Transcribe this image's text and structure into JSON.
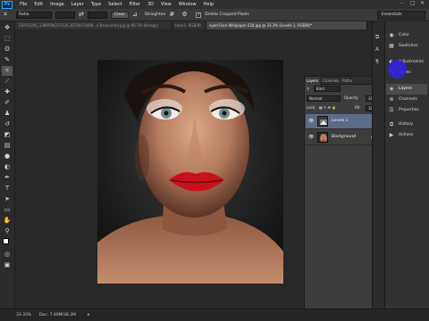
{
  "app": {
    "logo": "Ps"
  },
  "menu": [
    "File",
    "Edit",
    "Image",
    "Layer",
    "Type",
    "Select",
    "Filter",
    "3D",
    "View",
    "Window",
    "Help"
  ],
  "window_controls": {
    "minimize": "–",
    "maximize": "□",
    "close": "✕"
  },
  "options_bar": {
    "tool_icon": "crop-tool-icon",
    "ratio_select": "Ratio",
    "clear_button": "Clear",
    "straighten_label": "Straighten",
    "delete_cropped_label": "Delete Cropped Pixels",
    "delete_cropped_checked": "✓"
  },
  "workspace": {
    "label": "Essentials"
  },
  "tabs": [
    {
      "label": "1307f2345_1399594237126_6530073489...s-Recovered.jpg @ 66.7% (Hungry"
    },
    {
      "label": "Hear1, RGB/8)"
    },
    {
      "label": "eyed-Face-Wallpaper-224.jpg @ 33.3% (Levels 1, RGB/8)*"
    }
  ],
  "status": {
    "zoom": "33.33%",
    "doc": "Doc: 7.40M/38.2M"
  },
  "layers_panel": {
    "tabs": [
      "Layers",
      "Channels",
      "Paths"
    ],
    "menu_icon": "≡",
    "kind_label": "Kind",
    "blend_mode": "Normal",
    "opacity_label": "Opacity:",
    "opacity_value": "100%",
    "lock_label": "Lock:",
    "fill_label": "Fill:",
    "fill_value": "100%",
    "layers": [
      {
        "name": "Levels 1",
        "selected": true
      },
      {
        "name": "Background",
        "selected": false,
        "locked": true
      }
    ]
  },
  "dock": [
    {
      "label": "Color",
      "icon": "color-icon"
    },
    {
      "label": "Swatches",
      "icon": "swatches-icon"
    },
    {
      "label": "Adjustments",
      "icon": "adjustments-icon"
    },
    {
      "label": "Styles",
      "icon": "styles-icon"
    },
    {
      "label": "Layers",
      "icon": "layers-icon",
      "active": true
    },
    {
      "label": "Channels",
      "icon": "channels-icon"
    },
    {
      "label": "Properties",
      "icon": "properties-icon"
    },
    {
      "label": "History",
      "icon": "history-icon"
    },
    {
      "label": "Actions",
      "icon": "actions-icon"
    }
  ],
  "colors": {
    "accent": "#31a8ff",
    "selection": "#5b6b8a",
    "cursor": "#2f23d8",
    "lips": "#c8111b"
  }
}
